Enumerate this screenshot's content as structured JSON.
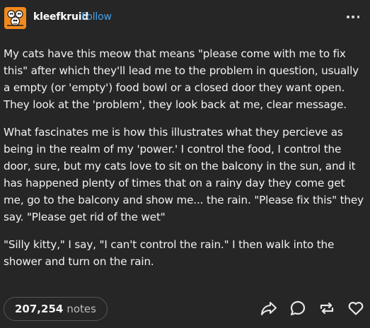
{
  "header": {
    "username": "kleefkruid",
    "follow_label": "Follow",
    "more_icon": "ellipsis-icon"
  },
  "post": {
    "paragraphs": [
      "My cats have this meow that means \"please come with me to fix this\" after which they'll lead me to the problem in question, usually a empty (or 'empty') food bowl or a closed door they want open. They look at the 'problem', they look back at me, clear message.",
      "What fascinates me is how this illustrates what they percieve as being in the realm of my 'power.' I control the food, I control the door, sure, but my cats love to sit on the balcony in the sun, and it has happened plenty of times that on a rainy day they come get me, go to the balcony and show me... the rain. \"Please fix this\" they say. \"Please get rid of the wet\"",
      "\"Silly kitty,\" I say, \"I can't control the rain.\" I then walk into the shower and turn on the rain."
    ]
  },
  "footer": {
    "notes_count": "207,254",
    "notes_label": "notes",
    "icons": [
      "share-icon",
      "reply-icon",
      "reblog-icon",
      "like-icon"
    ]
  },
  "colors": {
    "background": "#262626",
    "follow": "#4aa3e8",
    "avatar": "#f08a1e"
  }
}
